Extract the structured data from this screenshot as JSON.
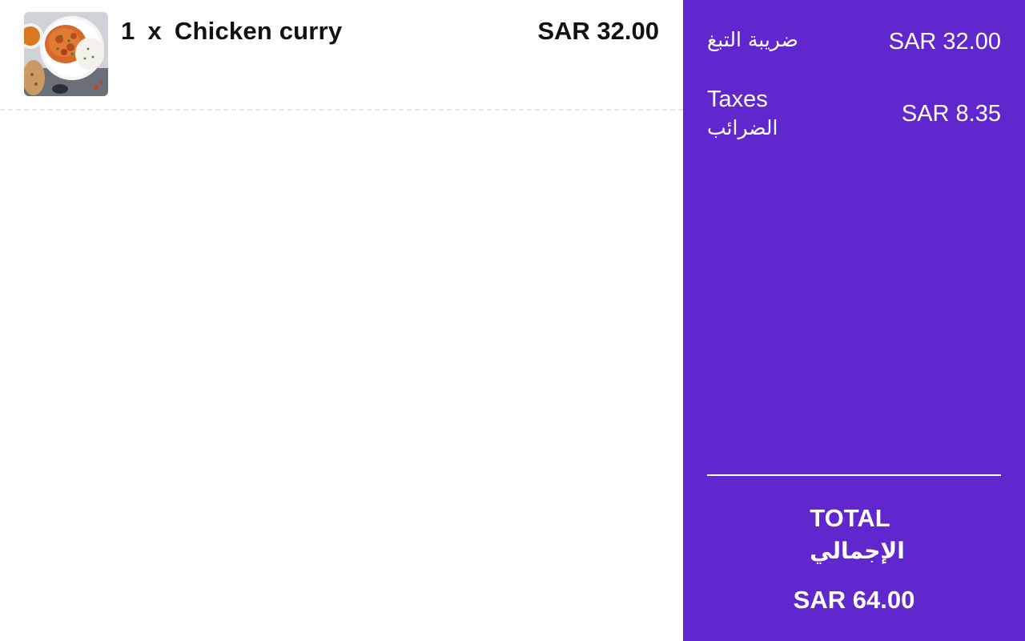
{
  "order": {
    "items": [
      {
        "quantity": "1",
        "multiplier": "x",
        "name": "Chicken curry",
        "price": "SAR 32.00",
        "image": "chicken-curry-photo"
      }
    ]
  },
  "summary": {
    "vat": {
      "label_ar": "ضريبة التبغ",
      "value": "SAR 32.00"
    },
    "taxes": {
      "label_en": "Taxes",
      "label_ar": "الضرائب",
      "value": "SAR 8.35"
    },
    "total": {
      "label_en": "TOTAL",
      "label_ar": "الإجمالي",
      "value": "SAR 64.00"
    }
  },
  "colors": {
    "summary_background": "#5f27cd",
    "summary_text": "#ffffff",
    "item_text": "#111111",
    "divider_dashed": "#e6e6e6"
  }
}
